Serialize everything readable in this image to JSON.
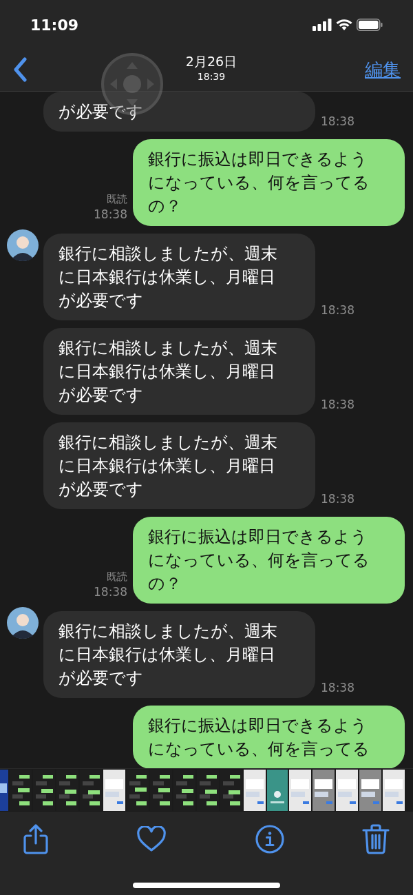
{
  "status_bar": {
    "time": "11:09"
  },
  "nav": {
    "title": "2月26日",
    "subtitle": "18:39",
    "edit": "編集"
  },
  "messages": [
    {
      "kind": "in",
      "avatar": false,
      "text": "が必要です",
      "time": "18:38"
    },
    {
      "kind": "out",
      "text": "銀行に振込は即日できるようになっている、何を言ってるの？",
      "read": "既読",
      "time": "18:38"
    },
    {
      "kind": "in",
      "avatar": true,
      "text": "銀行に相談しましたが、週末に日本銀行は休業し、月曜日が必要です",
      "time": "18:38"
    },
    {
      "kind": "in",
      "avatar": false,
      "text": "銀行に相談しましたが、週末に日本銀行は休業し、月曜日が必要です",
      "time": "18:38"
    },
    {
      "kind": "in",
      "avatar": false,
      "text": "銀行に相談しましたが、週末に日本銀行は休業し、月曜日が必要です",
      "time": "18:38"
    },
    {
      "kind": "out",
      "text": "銀行に振込は即日できるようになっている、何を言ってるの？",
      "read": "既読",
      "time": "18:38"
    },
    {
      "kind": "in",
      "avatar": true,
      "text": "銀行に相談しましたが、週末に日本銀行は休業し、月曜日が必要です",
      "time": "18:38"
    },
    {
      "kind": "out",
      "text": "銀行に振込は即日できるようになっている、何を言ってる"
    }
  ]
}
